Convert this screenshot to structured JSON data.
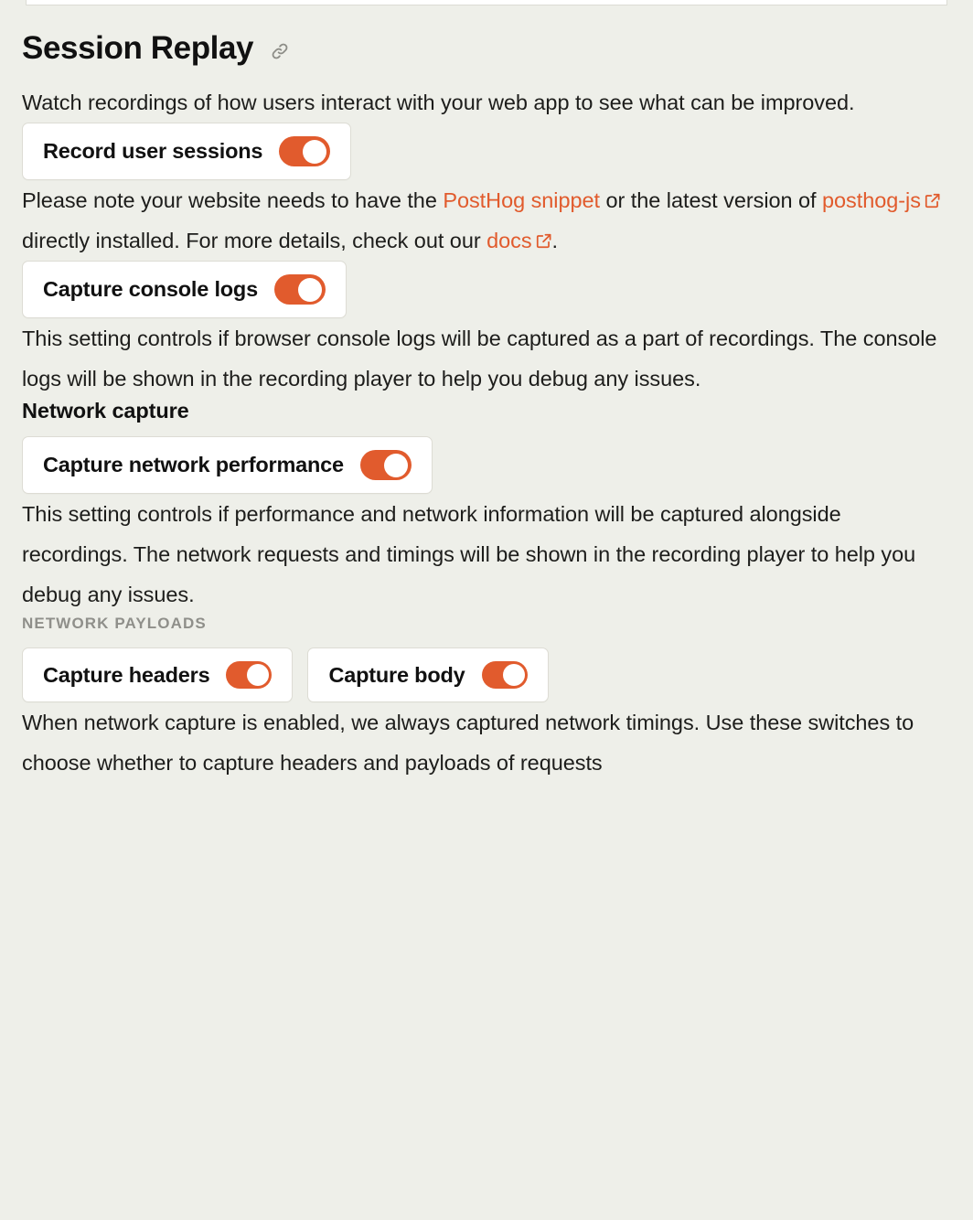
{
  "page": {
    "title": "Session Replay",
    "title_link_icon": "link-icon",
    "intro": "Watch recordings of how users interact with your web app to see what can be improved."
  },
  "record_sessions": {
    "label": "Record user sessions",
    "enabled": true
  },
  "snippet_note": {
    "part1": "Please note your website needs to have the ",
    "link1": "PostHog snippet",
    "part2": " or the latest version of ",
    "link2": "posthog-js",
    "link2_icon": "external-link-icon",
    "part3": " directly installed. For more details, check out our ",
    "link3": "docs",
    "link3_icon": "external-link-icon",
    "part4": "."
  },
  "console_logs": {
    "label": "Capture console logs",
    "enabled": true,
    "description": "This setting controls if browser console logs will be captured as a part of recordings. The console logs will be shown in the recording player to help you debug any issues."
  },
  "network_capture": {
    "heading": "Network capture",
    "label": "Capture network performance",
    "enabled": true,
    "description": "This setting controls if performance and network information will be captured alongside recordings. The network requests and timings will be shown in the recording player to help you debug any issues."
  },
  "network_payloads": {
    "heading": "NETWORK PAYLOADS",
    "headers_label": "Capture headers",
    "headers_enabled": true,
    "body_label": "Capture body",
    "body_enabled": true,
    "description": "When network capture is enabled, we always captured network timings. Use these switches to choose whether to capture headers and payloads of requests"
  },
  "colors": {
    "accent": "#e15b2d",
    "background": "#eeefe9",
    "card": "#ffffff",
    "card_border": "#dddcd4",
    "muted_text": "#8f8f8a",
    "text": "#151515"
  }
}
